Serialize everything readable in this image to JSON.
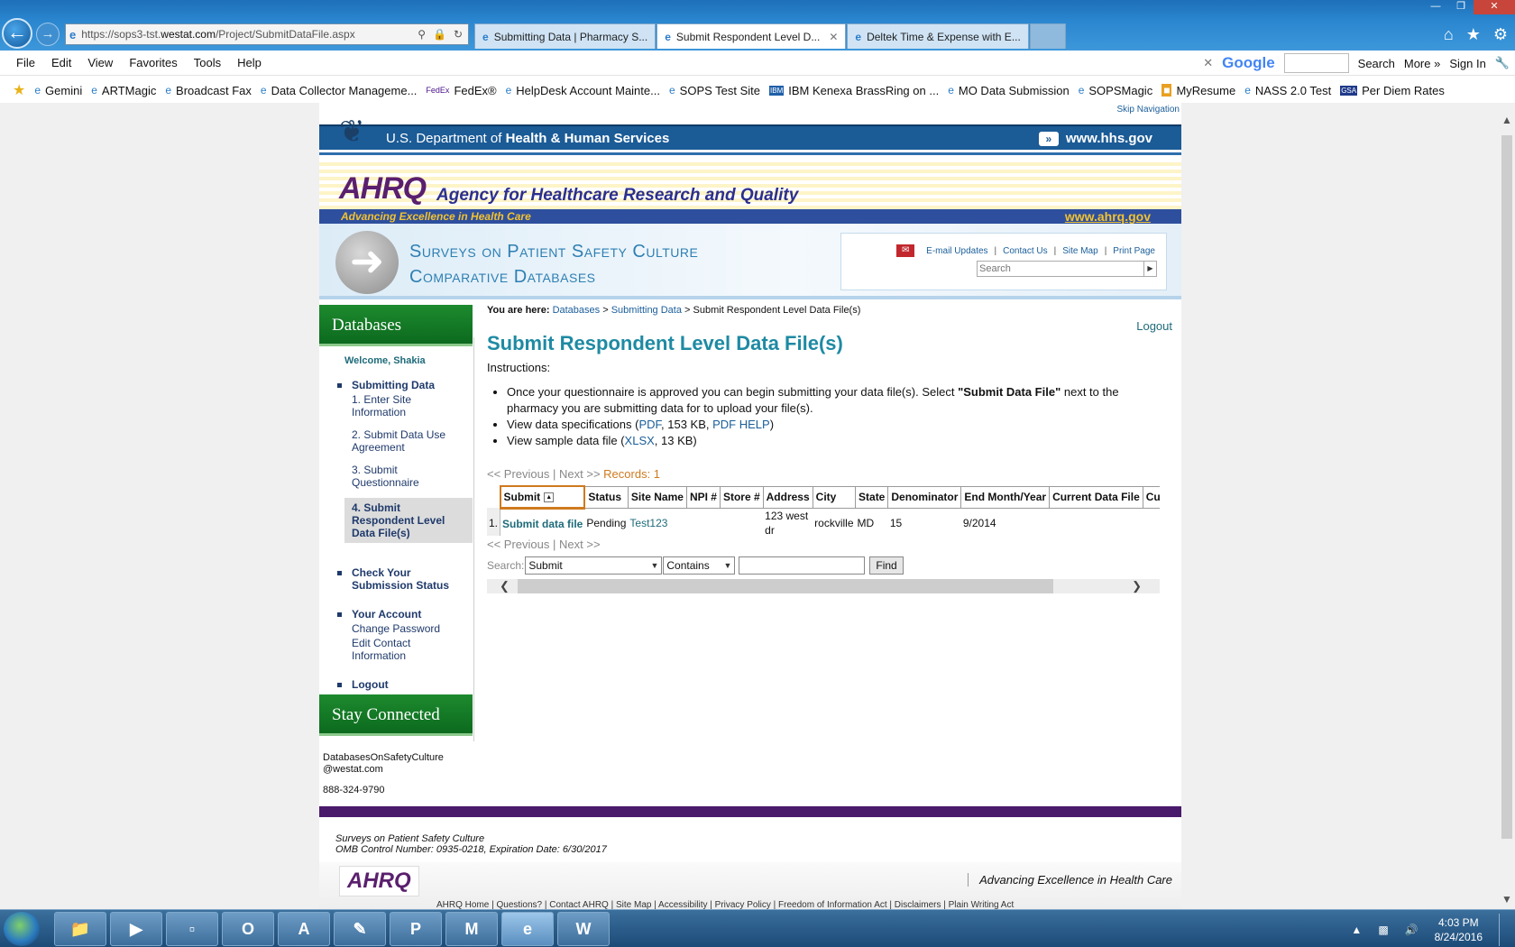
{
  "browser": {
    "address_url_prefix": "https://sops3-tst.",
    "address_url_domain": "westat.com",
    "address_url_path": "/Project/SubmitDataFile.aspx",
    "tabs": [
      {
        "label": "Submitting Data | Pharmacy S..."
      },
      {
        "label": "Submit Respondent Level D..."
      },
      {
        "label": "Deltek Time & Expense with E..."
      }
    ],
    "menu": [
      "File",
      "Edit",
      "View",
      "Favorites",
      "Tools",
      "Help"
    ],
    "google_label": "Google",
    "search_label": "Search",
    "more_label": "More »",
    "signin_label": "Sign In",
    "favorites": [
      "Gemini",
      "ARTMagic",
      "Broadcast Fax",
      "Data Collector Manageme...",
      "FedEx®",
      "HelpDesk Account Mainte...",
      "SOPS Test Site",
      "IBM Kenexa BrassRing on ...",
      "MO Data Submission",
      "SOPSMagic",
      "MyResume",
      "NASS 2.0 Test",
      "Per Diem Rates"
    ]
  },
  "site": {
    "skip_nav": "Skip Navigation",
    "hhs_prefix": "U.S. Department of ",
    "hhs_bold": "Health & Human Services",
    "hhs_url": "www.hhs.gov",
    "ahrq_logo": "AHRQ",
    "ahrq_name": "Agency for Healthcare Research and Quality",
    "ahrq_tagline": "Advancing Excellence in Health Care",
    "ahrq_url": "www.ahrq.gov",
    "banner_line1": "Surveys on Patient Safety Culture",
    "banner_line2": "Comparative Databases",
    "util_links": [
      "E-mail Updates",
      "Contact Us",
      "Site Map",
      "Print Page"
    ],
    "search_placeholder": "Search"
  },
  "leftnav": {
    "title": "Databases",
    "welcome": "Welcome, Shakia",
    "submitting": "Submitting Data",
    "steps": [
      "1. Enter Site Information",
      "2. Submit Data Use Agreement",
      "3. Submit Questionnaire",
      "4. Submit Respondent Level Data File(s)"
    ],
    "check_status": "Check Your Submission Status",
    "your_account": "Your Account",
    "change_password": "Change Password",
    "edit_contact": "Edit Contact Information",
    "logout": "Logout",
    "stay_connected": "Stay Connected",
    "email_line1": "DatabasesOnSafetyCulture",
    "email_line2": "@westat.com",
    "phone": "888-324-9790"
  },
  "main": {
    "crumb_label": "You are here:",
    "crumb_databases": "Databases",
    "crumb_submitting": "Submitting Data",
    "crumb_current": "Submit Respondent Level Data File(s)",
    "logout": "Logout",
    "title": "Submit Respondent Level Data File(s)",
    "instructions_label": "Instructions:",
    "bullet1_a": "Once your questionnaire is approved you can begin submitting your data file(s). Select ",
    "bullet1_b": "\"Submit Data File\"",
    "bullet1_c": " next to the pharmacy you are submitting data for to upload your file(s).",
    "bullet2_a": "View data specifications (",
    "bullet2_pdf": "PDF",
    "bullet2_b": ", 153 KB, ",
    "bullet2_help": "PDF HELP",
    "bullet2_c": ")",
    "bullet3_a": "View sample data file (",
    "bullet3_xlsx": "XLSX",
    "bullet3_b": ", 13 KB)",
    "pager_prev": "<< Previous",
    "pager_sep": "|",
    "pager_next": "Next >>",
    "records": "Records: 1",
    "columns": [
      "Submit",
      "Status",
      "Site Name",
      "NPI #",
      "Store #",
      "Address",
      "City",
      "State",
      "Denominator",
      "End Month/Year",
      "Current Data File",
      "Curren"
    ],
    "row": {
      "num": "1.",
      "submit": "Submit data file",
      "status": "Pending",
      "site_name": "Test123",
      "npi": "",
      "store": "",
      "address": "123 west dr",
      "city": "rockville",
      "state": "MD",
      "denominator": "15",
      "end_month_year": "9/2014",
      "current_data_file": "",
      "curren": ""
    },
    "search_label": "Search:",
    "search_field": "Submit",
    "search_op": "Contains",
    "find_label": "Find"
  },
  "footer": {
    "line1": "Surveys on Patient Safety Culture",
    "line2": "OMB Control Number: 0935-0218, Expiration Date: 6/30/2017",
    "logo": "AHRQ",
    "tagline": "Advancing Excellence in Health Care",
    "links": "AHRQ Home | Questions? | Contact AHRQ | Site Map | Accessibility | Privacy Policy | Freedom of Information Act | Disclaimers | Plain Writing Act"
  },
  "taskbar": {
    "time": "4:03 PM",
    "date": "8/24/2016"
  }
}
